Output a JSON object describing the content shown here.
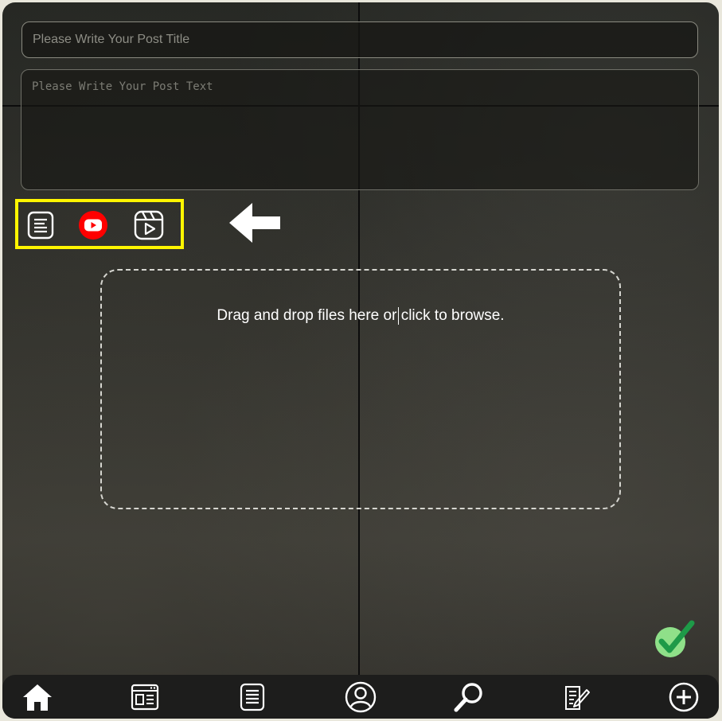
{
  "form": {
    "title_placeholder": "Please Write Your Post Title",
    "text_placeholder": "Please Write Your Post Text"
  },
  "post_type_toolbar": {
    "highlight_color": "#fff500",
    "items": [
      {
        "icon": "text-post-icon"
      },
      {
        "icon": "youtube-icon",
        "color": "#ff0000"
      },
      {
        "icon": "video-reel-icon"
      }
    ]
  },
  "dropzone": {
    "text": "Drag and drop files here or click to browse."
  },
  "confirm": {
    "icon": "checkmark-icon",
    "color": "#1e9a48"
  },
  "bottom_nav": {
    "items": [
      {
        "icon": "home-icon"
      },
      {
        "icon": "feed-icon"
      },
      {
        "icon": "list-icon"
      },
      {
        "icon": "profile-icon"
      },
      {
        "icon": "search-icon"
      },
      {
        "icon": "edit-document-icon"
      },
      {
        "icon": "add-circle-icon"
      }
    ]
  }
}
